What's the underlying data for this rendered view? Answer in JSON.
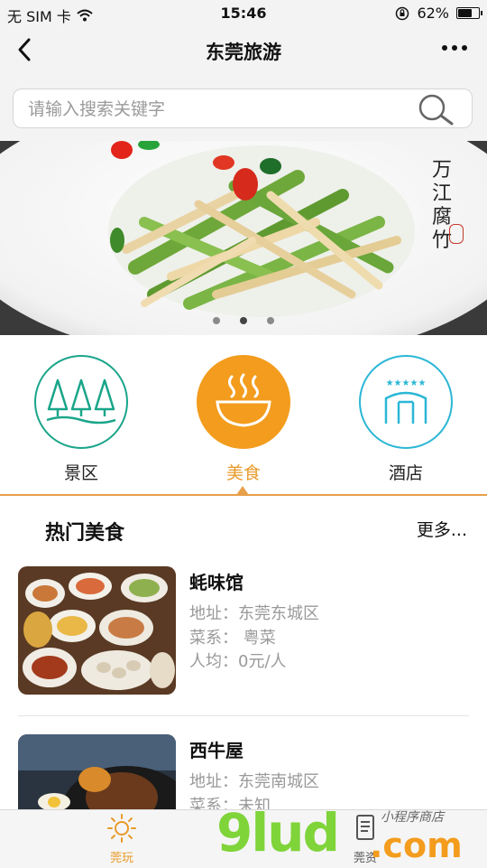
{
  "status": {
    "carrier": "无 SIM 卡",
    "time": "15:46",
    "battery": "62%",
    "battery_level": 0.62
  },
  "nav": {
    "title": "东莞旅游"
  },
  "search": {
    "placeholder": "请输入搜索关键字"
  },
  "banner": {
    "caption": [
      "万",
      "江",
      "腐",
      "竹"
    ],
    "slide_count": 3,
    "active_slide": 2
  },
  "categories": [
    {
      "label": "景区",
      "icon": "trees-icon",
      "color": "#1aa58a",
      "active": false
    },
    {
      "label": "美食",
      "icon": "steaming-bowl-icon",
      "color": "#f39c1d",
      "active": true
    },
    {
      "label": "酒店",
      "icon": "hotel-icon",
      "color": "#2bb7d6",
      "active": false
    }
  ],
  "section": {
    "title": "热门美食",
    "more": "更多..."
  },
  "restaurants": [
    {
      "name": "蚝味馆",
      "address": "地址：东莞东城区",
      "cuisine": "菜系：  粤菜",
      "avg": "人均：0元/人"
    },
    {
      "name": "西牛屋",
      "address": "地址：东莞南城区",
      "cuisine": "菜系：未知",
      "avg": ""
    }
  ],
  "tabbar": {
    "tabs": [
      {
        "label": "莞玩",
        "icon": "sun-icon",
        "color": "#e89a2a"
      },
      {
        "label": "莞资",
        "icon": "document-icon",
        "color": "#555555"
      }
    ]
  },
  "watermark": {
    "text": "9lud",
    "suffix": ".com",
    "script": "小程序商店"
  }
}
